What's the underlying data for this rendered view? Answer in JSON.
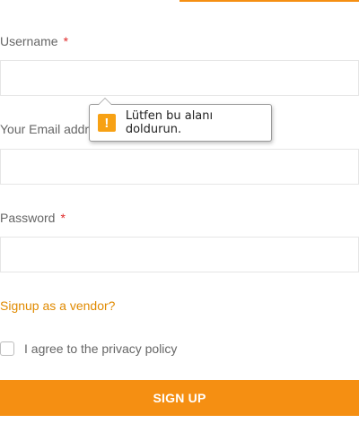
{
  "form": {
    "username_label": "Username",
    "email_label": "Your Email address",
    "password_label": "Password",
    "required_marker": "*",
    "vendor_link": "Signup as a vendor?",
    "agree_text": "I agree to the privacy policy",
    "agree_checked": false,
    "submit_label": "SIGN UP"
  },
  "validation_tooltip": {
    "icon": "warning-icon",
    "message": "Lütfen bu alanı doldurun."
  },
  "colors": {
    "accent": "#f58f12",
    "required": "#e02b2b",
    "link": "#e08a00"
  }
}
